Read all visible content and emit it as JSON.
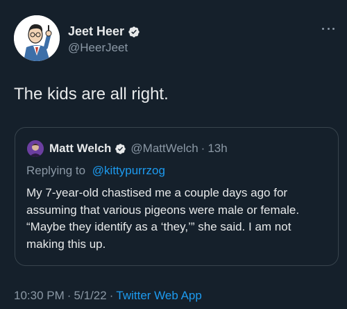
{
  "tweet": {
    "author": {
      "name": "Jeet Heer",
      "handle": "@HeerJeet",
      "verified": true,
      "avatar_icon": "cartoon-man-avatar"
    },
    "text": "The kids are all right.",
    "timestamp": "10:30 PM",
    "date": "5/1/22",
    "source_app": "Twitter Web App",
    "separator": "·"
  },
  "quoted_tweet": {
    "author": {
      "name": "Matt Welch",
      "handle": "@MattWelch",
      "verified": true,
      "avatar_icon": "user-photo-avatar"
    },
    "separator": "·",
    "time_ago": "13h",
    "replying_to_label": "Replying to",
    "replying_to_handle": "@kittypurrzog",
    "text": "My 7-year-old chastised me a couple days ago for assuming that various pigeons were male or female. “Maybe they identify as a ‘they,’” she said. I am not making this up."
  },
  "colors": {
    "background": "#15202b",
    "text_primary": "#e7e9ea",
    "text_secondary": "#8b98a5",
    "link": "#1d9bf0",
    "border": "#38444d",
    "verified_badge": "#e7e9ea"
  },
  "icons": {
    "verified": "verified-badge-icon",
    "more": "more-options-icon"
  }
}
